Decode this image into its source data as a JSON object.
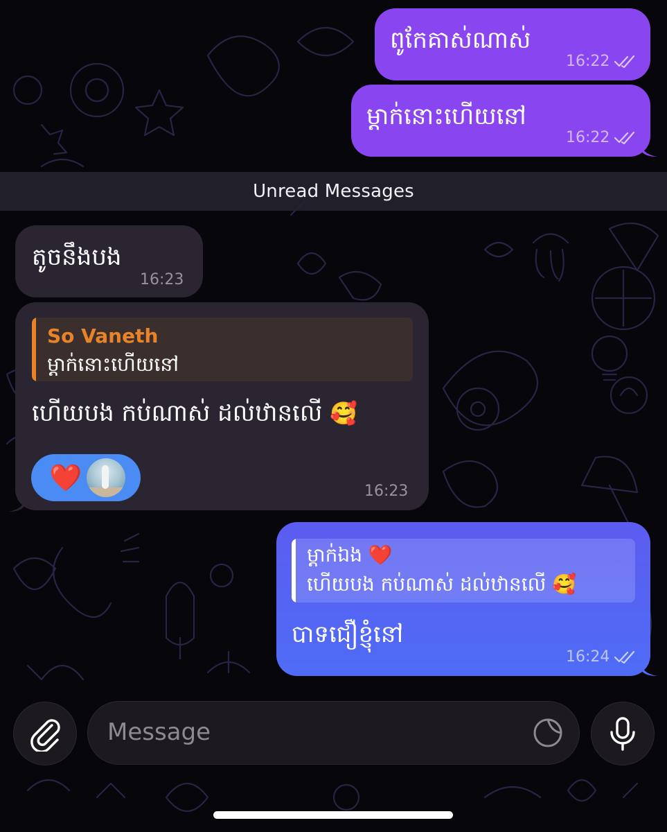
{
  "colors": {
    "outgoing_purple": "#8946f0",
    "outgoing_blue": "#5468f4",
    "incoming": "#2b2532",
    "reply_name": "#e8832a",
    "reaction_bg": "#4a8cf4",
    "background": "#07060a"
  },
  "messages": [
    {
      "text": "ពូកែគាស់ណាស់",
      "time": "16:22",
      "direction": "outgoing",
      "status": "read"
    },
    {
      "text": "ម្ដាក់នោះហើយនៅ",
      "time": "16:22",
      "direction": "outgoing",
      "status": "read"
    },
    {
      "text": "តូចនឹងបង",
      "time": "16:23",
      "direction": "incoming"
    },
    {
      "reply_name": "So Vaneth",
      "reply_text": "ម្ដាក់នោះហើយនៅ",
      "text": "ហើយបង កប់ណាស់ ដល់ឋានលើ",
      "emoji": "🥰",
      "time": "16:23",
      "direction": "incoming",
      "reaction": {
        "emoji": "❤️",
        "icon": "heart-icon"
      }
    },
    {
      "reply_name": "ម្ដាក់ឯង",
      "reply_name_emoji": "❤️",
      "reply_text": "ហើយបង កប់ណាស់ ដល់ឋានលើ",
      "reply_text_emoji": "🥰",
      "text": "បាទជឿខ្ញុំនៅ",
      "time": "16:24",
      "direction": "outgoing",
      "status": "read"
    }
  ],
  "unread_divider": "Unread Messages",
  "composer": {
    "placeholder": "Message",
    "attach_icon": "paperclip-icon",
    "sticker_icon": "sticker-icon",
    "mic_icon": "microphone-icon"
  }
}
